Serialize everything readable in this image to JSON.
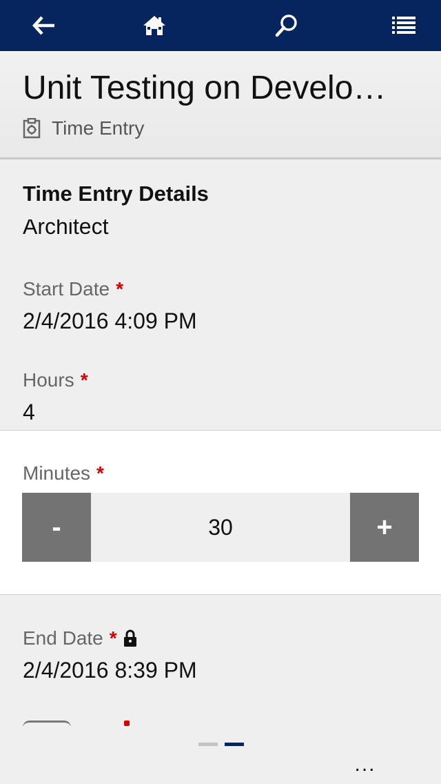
{
  "navbar": {
    "icons": [
      "back-arrow-icon",
      "home-icon",
      "search-icon",
      "list-icon"
    ],
    "color": "#06255f"
  },
  "header": {
    "title": "Unit Testing on Develo…",
    "entity_icon": "time-entry-icon",
    "entity_name": "Time Entry"
  },
  "form": {
    "section_title": "Time Entry Details",
    "partial_field_value": "Architect",
    "fields": {
      "start_date": {
        "label": "Start Date",
        "required": "*",
        "value": "2/4/2016 4:09 PM"
      },
      "hours": {
        "label": "Hours",
        "required": "*",
        "value": "4"
      },
      "minutes": {
        "label": "Minutes",
        "required": "*",
        "value": "30",
        "decrement": "-",
        "increment": "+"
      },
      "end_date": {
        "label": "End Date",
        "required": "*",
        "value": "2/4/2016 8:39 PM",
        "locked_icon": "lock-icon"
      }
    }
  },
  "footer": {
    "pager_pages": 2,
    "pager_active": 2,
    "more_label": "..."
  },
  "colors": {
    "required": "#d90000",
    "stepper_button": "#737373",
    "accent": "#06255f"
  }
}
